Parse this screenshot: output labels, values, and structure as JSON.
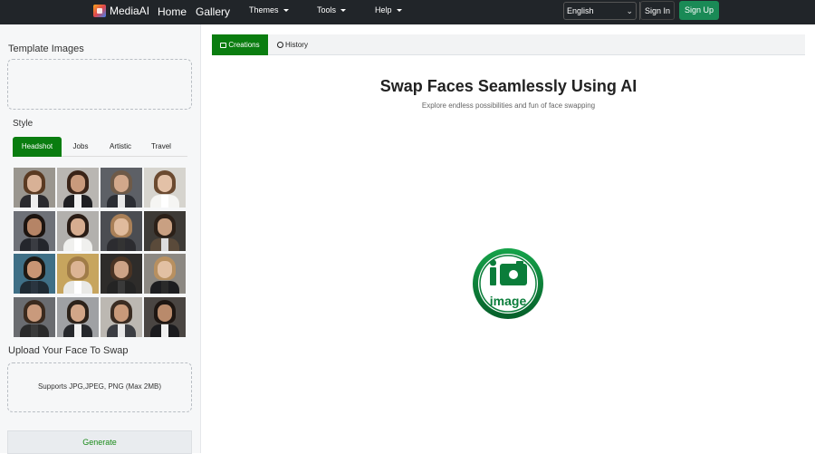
{
  "navbar": {
    "brand": "MediaAI",
    "links": [
      "Home",
      "Gallery"
    ],
    "dropdowns": [
      "Themes",
      "Tools",
      "Help"
    ],
    "language": "English",
    "sign_in": "Sign In",
    "sign_up": "Sign Up"
  },
  "sidebar": {
    "template_images_title": "Template Images",
    "style_title": "Style",
    "style_tabs": [
      "Headshot",
      "Jobs",
      "Artistic",
      "Travel"
    ],
    "upload_title": "Upload Your Face To Swap",
    "upload_hint": "Supports JPG,JPEG, PNG (Max 2MB)",
    "generate_label": "Generate"
  },
  "main": {
    "tabs": [
      "Creations",
      "History"
    ],
    "title": "Swap Faces Seamlessly Using AI",
    "subtitle": "Explore endless possibilities and fun of face swapping",
    "placeholder_text": "image"
  },
  "colors": {
    "navbar_bg": "#212529",
    "accent_green": "#0a7d10",
    "signup_green": "#1a8a56"
  },
  "icons": [
    "logo-icon",
    "caret-down-icon",
    "chevron-down-icon",
    "folder-icon",
    "clock-icon",
    "image-placeholder-icon"
  ]
}
